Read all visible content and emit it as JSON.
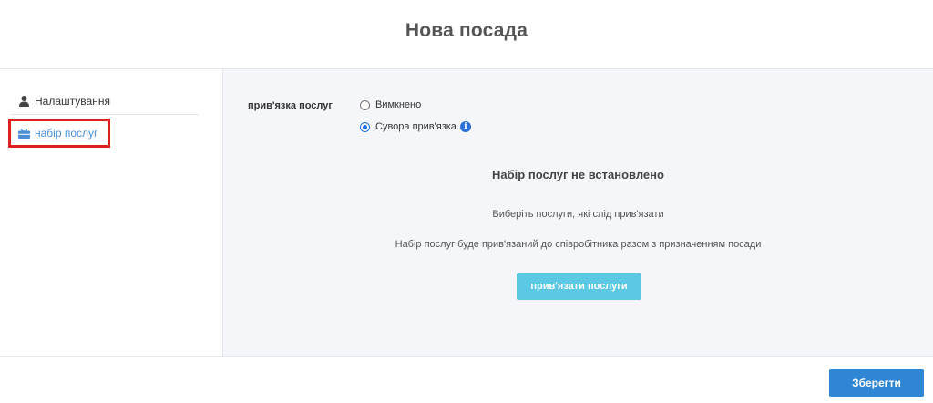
{
  "header": {
    "title": "Нова посада"
  },
  "sidebar": {
    "items": [
      {
        "label": "Налаштування",
        "icon": "user-icon",
        "active": false
      },
      {
        "label": "набір послуг",
        "icon": "briefcase-icon",
        "active": true
      }
    ],
    "active_color": "#4d8fd6",
    "highlight_color": "#e02020"
  },
  "main": {
    "binding_label": "прив'язка послуг",
    "radio_options": [
      {
        "label": "Вимкнено",
        "checked": false
      },
      {
        "label": "Сувора прив'язка",
        "checked": true
      }
    ],
    "info_icon": "info-icon",
    "empty_title": "Набір послуг не встановлено",
    "empty_line1": "Виберіть послуги, які слід прив'язати",
    "empty_line2": "Набір послуг буде прив'язаний до співробітника разом з призначенням посади",
    "bind_button": "прив'язати послуги",
    "bind_button_color": "#5bc8e4"
  },
  "footer": {
    "save_button": "Зберегти",
    "save_button_color": "#2f86d4"
  }
}
